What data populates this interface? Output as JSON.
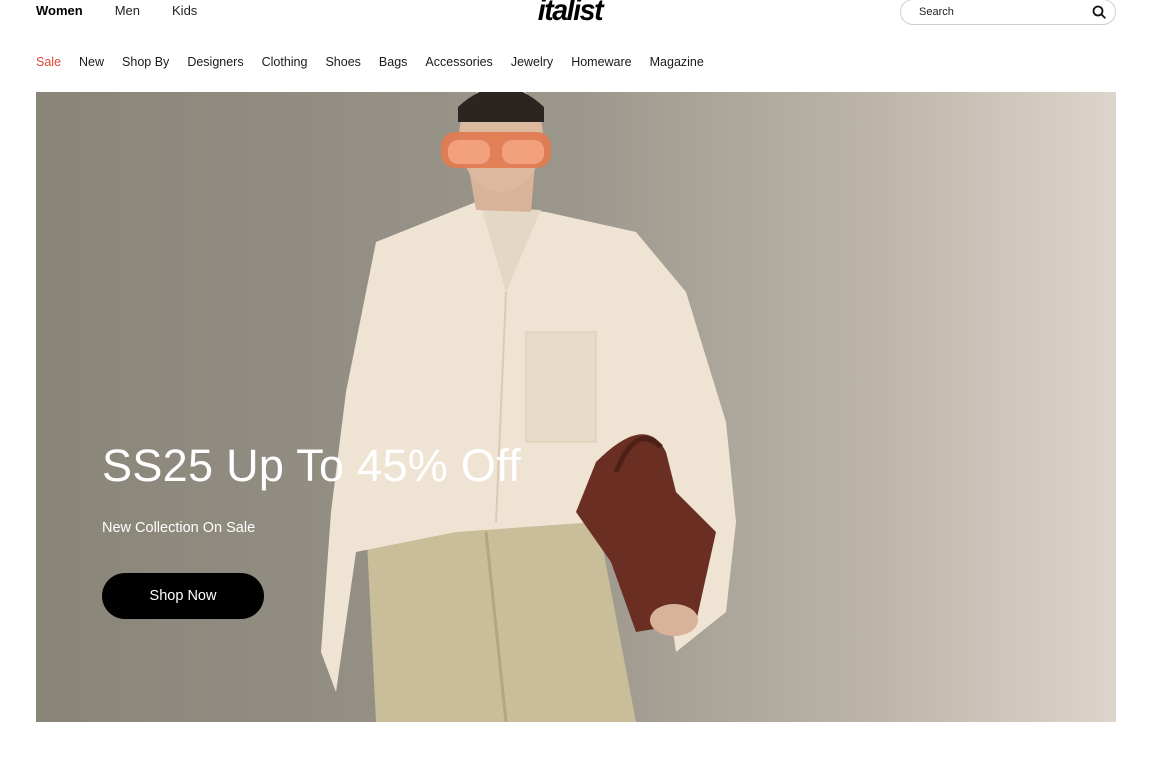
{
  "header": {
    "gender_tabs": [
      {
        "label": "Women",
        "active": true
      },
      {
        "label": "Men",
        "active": false
      },
      {
        "label": "Kids",
        "active": false
      }
    ],
    "logo": "italist",
    "search": {
      "placeholder": "Search",
      "icon": "search-icon"
    }
  },
  "nav": {
    "items": [
      {
        "label": "Sale",
        "highlight": "#e0473a"
      },
      {
        "label": "New"
      },
      {
        "label": "Shop By"
      },
      {
        "label": "Designers"
      },
      {
        "label": "Clothing"
      },
      {
        "label": "Shoes"
      },
      {
        "label": "Bags"
      },
      {
        "label": "Accessories"
      },
      {
        "label": "Jewelry"
      },
      {
        "label": "Homeware"
      },
      {
        "label": "Magazine"
      }
    ]
  },
  "hero": {
    "title": "SS25 Up To 45% Off",
    "subtitle": "New Collection On Sale",
    "cta": "Shop Now"
  },
  "colors": {
    "accent_sale": "#e0473a",
    "button_bg": "#000000",
    "button_text": "#ffffff"
  }
}
